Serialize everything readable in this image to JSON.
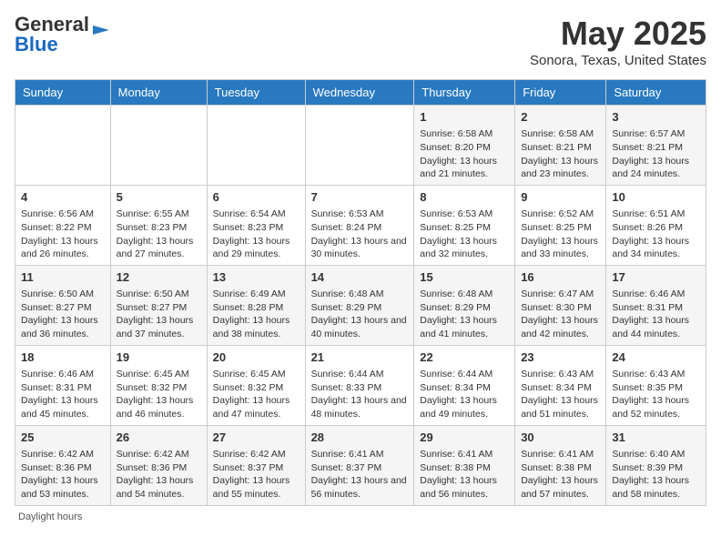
{
  "header": {
    "logo_line1": "General",
    "logo_line2": "Blue",
    "month_year": "May 2025",
    "location": "Sonora, Texas, United States"
  },
  "days_of_week": [
    "Sunday",
    "Monday",
    "Tuesday",
    "Wednesday",
    "Thursday",
    "Friday",
    "Saturday"
  ],
  "weeks": [
    [
      {
        "day": "",
        "info": ""
      },
      {
        "day": "",
        "info": ""
      },
      {
        "day": "",
        "info": ""
      },
      {
        "day": "",
        "info": ""
      },
      {
        "day": "1",
        "info": "Sunrise: 6:58 AM\nSunset: 8:20 PM\nDaylight: 13 hours and 21 minutes."
      },
      {
        "day": "2",
        "info": "Sunrise: 6:58 AM\nSunset: 8:21 PM\nDaylight: 13 hours and 23 minutes."
      },
      {
        "day": "3",
        "info": "Sunrise: 6:57 AM\nSunset: 8:21 PM\nDaylight: 13 hours and 24 minutes."
      }
    ],
    [
      {
        "day": "4",
        "info": "Sunrise: 6:56 AM\nSunset: 8:22 PM\nDaylight: 13 hours and 26 minutes."
      },
      {
        "day": "5",
        "info": "Sunrise: 6:55 AM\nSunset: 8:23 PM\nDaylight: 13 hours and 27 minutes."
      },
      {
        "day": "6",
        "info": "Sunrise: 6:54 AM\nSunset: 8:23 PM\nDaylight: 13 hours and 29 minutes."
      },
      {
        "day": "7",
        "info": "Sunrise: 6:53 AM\nSunset: 8:24 PM\nDaylight: 13 hours and 30 minutes."
      },
      {
        "day": "8",
        "info": "Sunrise: 6:53 AM\nSunset: 8:25 PM\nDaylight: 13 hours and 32 minutes."
      },
      {
        "day": "9",
        "info": "Sunrise: 6:52 AM\nSunset: 8:25 PM\nDaylight: 13 hours and 33 minutes."
      },
      {
        "day": "10",
        "info": "Sunrise: 6:51 AM\nSunset: 8:26 PM\nDaylight: 13 hours and 34 minutes."
      }
    ],
    [
      {
        "day": "11",
        "info": "Sunrise: 6:50 AM\nSunset: 8:27 PM\nDaylight: 13 hours and 36 minutes."
      },
      {
        "day": "12",
        "info": "Sunrise: 6:50 AM\nSunset: 8:27 PM\nDaylight: 13 hours and 37 minutes."
      },
      {
        "day": "13",
        "info": "Sunrise: 6:49 AM\nSunset: 8:28 PM\nDaylight: 13 hours and 38 minutes."
      },
      {
        "day": "14",
        "info": "Sunrise: 6:48 AM\nSunset: 8:29 PM\nDaylight: 13 hours and 40 minutes."
      },
      {
        "day": "15",
        "info": "Sunrise: 6:48 AM\nSunset: 8:29 PM\nDaylight: 13 hours and 41 minutes."
      },
      {
        "day": "16",
        "info": "Sunrise: 6:47 AM\nSunset: 8:30 PM\nDaylight: 13 hours and 42 minutes."
      },
      {
        "day": "17",
        "info": "Sunrise: 6:46 AM\nSunset: 8:31 PM\nDaylight: 13 hours and 44 minutes."
      }
    ],
    [
      {
        "day": "18",
        "info": "Sunrise: 6:46 AM\nSunset: 8:31 PM\nDaylight: 13 hours and 45 minutes."
      },
      {
        "day": "19",
        "info": "Sunrise: 6:45 AM\nSunset: 8:32 PM\nDaylight: 13 hours and 46 minutes."
      },
      {
        "day": "20",
        "info": "Sunrise: 6:45 AM\nSunset: 8:32 PM\nDaylight: 13 hours and 47 minutes."
      },
      {
        "day": "21",
        "info": "Sunrise: 6:44 AM\nSunset: 8:33 PM\nDaylight: 13 hours and 48 minutes."
      },
      {
        "day": "22",
        "info": "Sunrise: 6:44 AM\nSunset: 8:34 PM\nDaylight: 13 hours and 49 minutes."
      },
      {
        "day": "23",
        "info": "Sunrise: 6:43 AM\nSunset: 8:34 PM\nDaylight: 13 hours and 51 minutes."
      },
      {
        "day": "24",
        "info": "Sunrise: 6:43 AM\nSunset: 8:35 PM\nDaylight: 13 hours and 52 minutes."
      }
    ],
    [
      {
        "day": "25",
        "info": "Sunrise: 6:42 AM\nSunset: 8:36 PM\nDaylight: 13 hours and 53 minutes."
      },
      {
        "day": "26",
        "info": "Sunrise: 6:42 AM\nSunset: 8:36 PM\nDaylight: 13 hours and 54 minutes."
      },
      {
        "day": "27",
        "info": "Sunrise: 6:42 AM\nSunset: 8:37 PM\nDaylight: 13 hours and 55 minutes."
      },
      {
        "day": "28",
        "info": "Sunrise: 6:41 AM\nSunset: 8:37 PM\nDaylight: 13 hours and 56 minutes."
      },
      {
        "day": "29",
        "info": "Sunrise: 6:41 AM\nSunset: 8:38 PM\nDaylight: 13 hours and 56 minutes."
      },
      {
        "day": "30",
        "info": "Sunrise: 6:41 AM\nSunset: 8:38 PM\nDaylight: 13 hours and 57 minutes."
      },
      {
        "day": "31",
        "info": "Sunrise: 6:40 AM\nSunset: 8:39 PM\nDaylight: 13 hours and 58 minutes."
      }
    ]
  ],
  "footer": "Daylight hours"
}
